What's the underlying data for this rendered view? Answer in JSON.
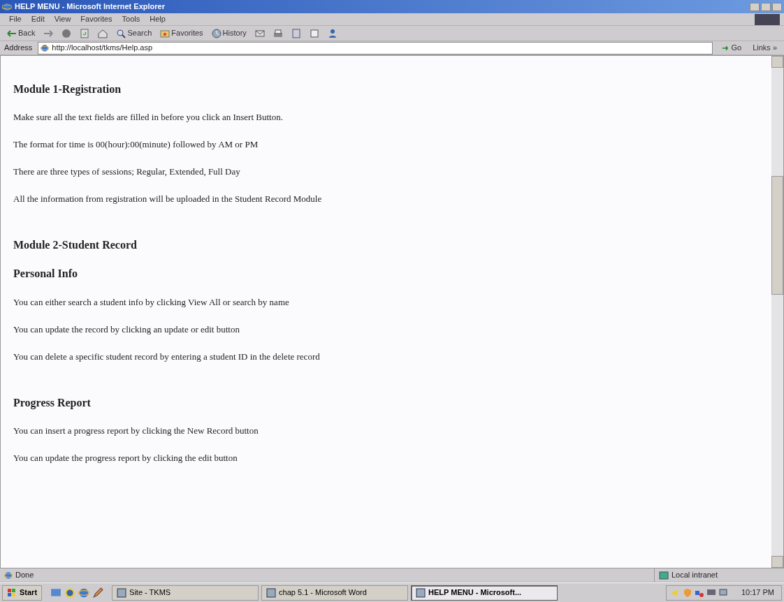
{
  "window": {
    "title": "HELP MENU - Microsoft Internet Explorer"
  },
  "menu": [
    "File",
    "Edit",
    "View",
    "Favorites",
    "Tools",
    "Help"
  ],
  "toolbar": [
    {
      "kind": "back",
      "label": "Back"
    },
    {
      "kind": "forward"
    },
    {
      "kind": "stop"
    },
    {
      "kind": "refresh"
    },
    {
      "kind": "home"
    },
    {
      "kind": "search",
      "label": "Search"
    },
    {
      "kind": "favorites",
      "label": "Favorites"
    },
    {
      "kind": "history",
      "label": "History"
    },
    {
      "kind": "mail"
    },
    {
      "kind": "print"
    },
    {
      "kind": "edit"
    },
    {
      "kind": "discuss"
    },
    {
      "kind": "messenger"
    }
  ],
  "address": {
    "label": "Address",
    "url": "http://localhost/tkms/Help.asp",
    "go": "Go",
    "links": "Links »"
  },
  "content": [
    {
      "kind": "heading",
      "text": "Module 1-Registration"
    },
    {
      "kind": "paragraph",
      "text": "Make sure all the text fields are filled in before you click an Insert Button."
    },
    {
      "kind": "paragraph",
      "text": "The format for time is 00(hour):00(minute) followed by AM or PM"
    },
    {
      "kind": "paragraph",
      "text": "There are three types of sessions; Regular, Extended, Full Day"
    },
    {
      "kind": "paragraph",
      "text": "All the information from registration will be uploaded in the Student Record Module"
    },
    {
      "kind": "heading",
      "text": "Module 2-Student Record"
    },
    {
      "kind": "subheading",
      "text": "Personal Info"
    },
    {
      "kind": "paragraph",
      "text": "You can either search a student info by clicking View All or search by name"
    },
    {
      "kind": "paragraph",
      "text": "You can update the record by clicking an update or edit button"
    },
    {
      "kind": "paragraph",
      "text": "You can delete a specific student record by entering a student ID in the delete record"
    },
    {
      "kind": "heading",
      "text": "Progress Report"
    },
    {
      "kind": "paragraph",
      "text": "You can insert a progress report by clicking the New Record button"
    },
    {
      "kind": "paragraph",
      "text": "You can update the progress report by clicking the edit button"
    }
  ],
  "status_bar": {
    "text": "Done",
    "zone": "Local intranet"
  },
  "taskbar": {
    "start": "Start",
    "tasks": [
      {
        "label": "Site - TKMS",
        "selected": false
      },
      {
        "label": "chap 5.1 - Microsoft Word",
        "selected": false
      },
      {
        "label": "HELP MENU - Microsoft...",
        "selected": true
      }
    ],
    "clock": "10:17 PM"
  }
}
